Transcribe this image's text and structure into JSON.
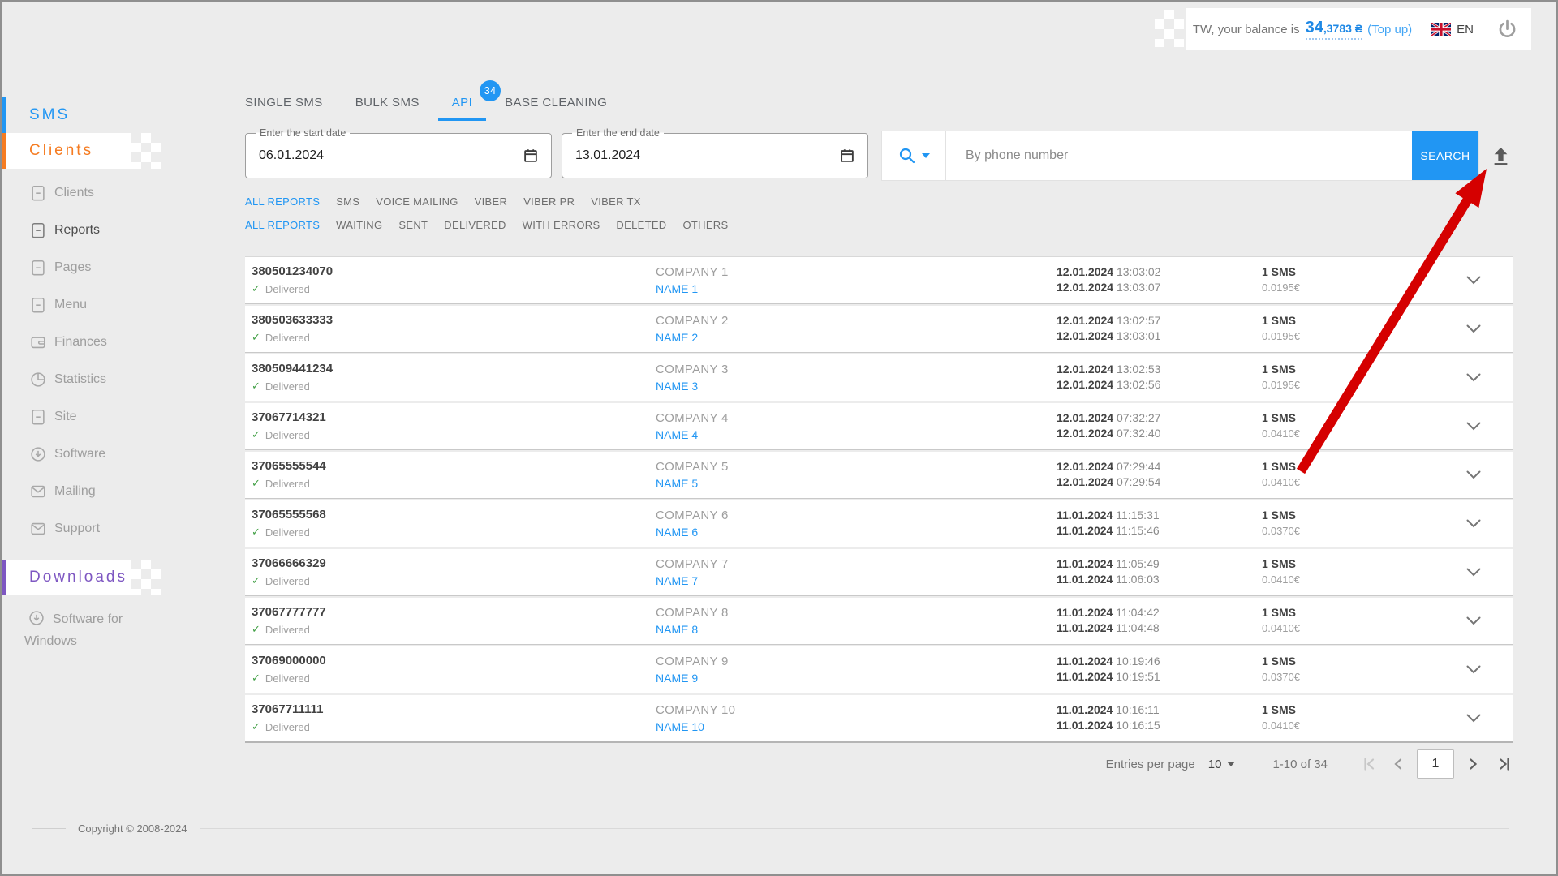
{
  "topbar": {
    "balance_prefix": "TW, your balance is",
    "balance_main": "34",
    "balance_decimals": ",3783 ₴",
    "top_up_label": "(Top up)",
    "language": "EN"
  },
  "sidebar": {
    "sms_section": "SMS",
    "clients_section": "Clients",
    "downloads_section": "Downloads",
    "software_for_windows": "Software for Windows",
    "items": [
      {
        "label": "Clients",
        "icon": "document-icon"
      },
      {
        "label": "Reports",
        "icon": "document-icon",
        "active": true
      },
      {
        "label": "Pages",
        "icon": "document-icon"
      },
      {
        "label": "Menu",
        "icon": "document-icon"
      },
      {
        "label": "Finances",
        "icon": "wallet-icon"
      },
      {
        "label": "Statistics",
        "icon": "pie-chart-icon"
      },
      {
        "label": "Site",
        "icon": "document-icon"
      },
      {
        "label": "Software",
        "icon": "download-icon"
      },
      {
        "label": "Mailing",
        "icon": "envelope-icon"
      },
      {
        "label": "Support",
        "icon": "envelope-icon"
      }
    ]
  },
  "tabs": [
    {
      "label": "SINGLE SMS"
    },
    {
      "label": "BULK SMS"
    },
    {
      "label": "API",
      "badge": "34",
      "active": true
    },
    {
      "label": "BASE CLEANING"
    }
  ],
  "controls": {
    "start_date": {
      "label": "Enter the start date",
      "value": "06.01.2024"
    },
    "end_date": {
      "label": "Enter the end date",
      "value": "13.01.2024"
    },
    "search_placeholder": "By phone number",
    "search_button": "SEARCH"
  },
  "report_type_filters": [
    {
      "label": "ALL REPORTS",
      "active": true
    },
    {
      "label": "SMS"
    },
    {
      "label": "VOICE MAILING"
    },
    {
      "label": "VIBER"
    },
    {
      "label": "VIBER PR"
    },
    {
      "label": "VIBER TX"
    }
  ],
  "status_filters": [
    {
      "label": "ALL REPORTS",
      "active": true
    },
    {
      "label": "WAITING"
    },
    {
      "label": "SENT"
    },
    {
      "label": "DELIVERED"
    },
    {
      "label": "WITH ERRORS"
    },
    {
      "label": "DELETED"
    },
    {
      "label": "OTHERS"
    }
  ],
  "table": {
    "rows": [
      {
        "phone": "380501234070",
        "status": "Delivered",
        "company": "COMPANY 1",
        "name": "NAME 1",
        "sent_date": "12.01.2024",
        "sent_time": "13:03:02",
        "delivered_date": "12.01.2024",
        "delivered_time": "13:03:07",
        "count": "1 SMS",
        "price": "0.0195€"
      },
      {
        "phone": "380503633333",
        "status": "Delivered",
        "company": "COMPANY 2",
        "name": "NAME 2",
        "sent_date": "12.01.2024",
        "sent_time": "13:02:57",
        "delivered_date": "12.01.2024",
        "delivered_time": "13:03:01",
        "count": "1 SMS",
        "price": "0.0195€"
      },
      {
        "phone": "380509441234",
        "status": "Delivered",
        "company": "COMPANY 3",
        "name": "NAME 3",
        "sent_date": "12.01.2024",
        "sent_time": "13:02:53",
        "delivered_date": "12.01.2024",
        "delivered_time": "13:02:56",
        "count": "1 SMS",
        "price": "0.0195€"
      },
      {
        "phone": "37067714321",
        "status": "Delivered",
        "company": "COMPANY 4",
        "name": "NAME 4",
        "sent_date": "12.01.2024",
        "sent_time": "07:32:27",
        "delivered_date": "12.01.2024",
        "delivered_time": "07:32:40",
        "count": "1 SMS",
        "price": "0.0410€"
      },
      {
        "phone": "37065555544",
        "status": "Delivered",
        "company": "COMPANY 5",
        "name": "NAME 5",
        "sent_date": "12.01.2024",
        "sent_time": "07:29:44",
        "delivered_date": "12.01.2024",
        "delivered_time": "07:29:54",
        "count": "1 SMS",
        "price": "0.0410€"
      },
      {
        "phone": "37065555568",
        "status": "Delivered",
        "company": "COMPANY 6",
        "name": "NAME 6",
        "sent_date": "11.01.2024",
        "sent_time": "11:15:31",
        "delivered_date": "11.01.2024",
        "delivered_time": "11:15:46",
        "count": "1 SMS",
        "price": "0.0370€"
      },
      {
        "phone": "37066666329",
        "status": "Delivered",
        "company": "COMPANY 7",
        "name": "NAME 7",
        "sent_date": "11.01.2024",
        "sent_time": "11:05:49",
        "delivered_date": "11.01.2024",
        "delivered_time": "11:06:03",
        "count": "1 SMS",
        "price": "0.0410€"
      },
      {
        "phone": "37067777777",
        "status": "Delivered",
        "company": "COMPANY 8",
        "name": "NAME 8",
        "sent_date": "11.01.2024",
        "sent_time": "11:04:42",
        "delivered_date": "11.01.2024",
        "delivered_time": "11:04:48",
        "count": "1 SMS",
        "price": "0.0410€"
      },
      {
        "phone": "37069000000",
        "status": "Delivered",
        "company": "COMPANY 9",
        "name": "NAME 9",
        "sent_date": "11.01.2024",
        "sent_time": "10:19:46",
        "delivered_date": "11.01.2024",
        "delivered_time": "10:19:51",
        "count": "1 SMS",
        "price": "0.0370€"
      },
      {
        "phone": "37067711111",
        "status": "Delivered",
        "company": "COMPANY 10",
        "name": "NAME 10",
        "sent_date": "11.01.2024",
        "sent_time": "10:16:11",
        "delivered_date": "11.01.2024",
        "delivered_time": "10:16:15",
        "count": "1 SMS",
        "price": "0.0410€"
      }
    ]
  },
  "pagination": {
    "entries_label": "Entries per page",
    "per_page": "10",
    "range": "1-10 of 34",
    "page": "1"
  },
  "footer": {
    "copyright": "Copyright © 2008-2024"
  },
  "colors": {
    "accent": "#2196f3",
    "clients-orange": "#f57c22",
    "downloads-purple": "#7e57c2",
    "delivered-green": "#43a047",
    "arrow-red": "#d50000"
  }
}
